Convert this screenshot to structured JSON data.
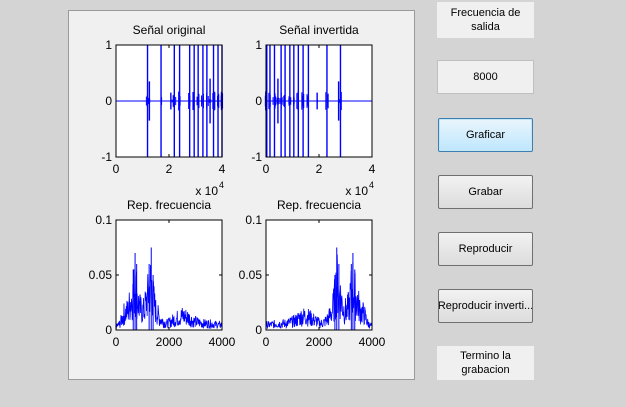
{
  "panel": {
    "freq_label_line1": "Frecuencia de",
    "freq_label_line2": "salida",
    "freq_value": "8000",
    "status_line1": "Termino la",
    "status_line2": "grabacion"
  },
  "buttons": {
    "graficar": "Graficar",
    "grabar": "Grabar",
    "reproducir": "Reproducir",
    "reproducir_invertida": "Reproducir inverti..."
  },
  "colors": {
    "signal": "#0000ff",
    "axes_bg": "#ffffff",
    "figure_bg": "#f0f0f0",
    "active_button": "#bee6fd"
  },
  "chart_data": [
    {
      "type": "line",
      "title": "Señal original",
      "xlabel": "",
      "ylabel": "",
      "xlim": [
        0,
        40000
      ],
      "ylim": [
        -1,
        1
      ],
      "x_ticks": [
        "0",
        "2",
        "4"
      ],
      "y_ticks": [
        "-1",
        "0",
        "1"
      ],
      "x_exponent": "x 10",
      "x_exponent_power": "4",
      "bursts": [
        {
          "x": 11900,
          "amp": 1.0
        },
        {
          "x": 12600,
          "amp": 0.35
        },
        {
          "x": 17000,
          "amp": 1.0
        },
        {
          "x": 20700,
          "amp": 0.15
        },
        {
          "x": 22000,
          "amp": 1.0
        },
        {
          "x": 24000,
          "amp": 1.0
        },
        {
          "x": 27800,
          "amp": 1.0
        },
        {
          "x": 29500,
          "amp": 1.0
        },
        {
          "x": 31000,
          "amp": 1.0
        },
        {
          "x": 32800,
          "amp": 1.0
        },
        {
          "x": 34300,
          "amp": 1.0
        },
        {
          "x": 35500,
          "amp": 0.4
        },
        {
          "x": 36800,
          "amp": 1.0
        },
        {
          "x": 38500,
          "amp": 1.0
        },
        {
          "x": 40000,
          "amp": 1.0
        }
      ]
    },
    {
      "type": "line",
      "title": "Señal invertida",
      "xlabel": "",
      "ylabel": "",
      "xlim": [
        0,
        40000
      ],
      "ylim": [
        -1,
        1
      ],
      "x_ticks": [
        "0",
        "2",
        "4"
      ],
      "y_ticks": [
        "-1",
        "0",
        "1"
      ],
      "x_exponent": "x 10",
      "x_exponent_power": "4",
      "bursts": [
        {
          "x": 300,
          "amp": 1.0
        },
        {
          "x": 1500,
          "amp": 1.0
        },
        {
          "x": 3200,
          "amp": 1.0
        },
        {
          "x": 4500,
          "amp": 0.4
        },
        {
          "x": 5700,
          "amp": 1.0
        },
        {
          "x": 7200,
          "amp": 1.0
        },
        {
          "x": 9000,
          "amp": 1.0
        },
        {
          "x": 10500,
          "amp": 1.0
        },
        {
          "x": 12200,
          "amp": 1.0
        },
        {
          "x": 14000,
          "amp": 1.0
        },
        {
          "x": 16000,
          "amp": 1.0
        },
        {
          "x": 19300,
          "amp": 0.15
        },
        {
          "x": 23000,
          "amp": 1.0
        },
        {
          "x": 27400,
          "amp": 0.35
        },
        {
          "x": 28100,
          "amp": 1.0
        }
      ]
    },
    {
      "type": "line",
      "title": "Rep. frecuencia",
      "xlabel": "",
      "ylabel": "",
      "xlim": [
        0,
        4000
      ],
      "ylim": [
        0,
        0.1
      ],
      "x_ticks": [
        "0",
        "2000",
        "4000"
      ],
      "y_ticks": [
        "0",
        "0.05",
        "0.1"
      ],
      "envelope": [
        [
          0,
          0.005
        ],
        [
          150,
          0.01
        ],
        [
          300,
          0.025
        ],
        [
          450,
          0.03
        ],
        [
          550,
          0.045
        ],
        [
          650,
          0.055
        ],
        [
          720,
          0.07
        ],
        [
          780,
          0.06
        ],
        [
          850,
          0.04
        ],
        [
          950,
          0.03
        ],
        [
          1050,
          0.03
        ],
        [
          1150,
          0.045
        ],
        [
          1250,
          0.06
        ],
        [
          1330,
          0.075
        ],
        [
          1400,
          0.05
        ],
        [
          1500,
          0.03
        ],
        [
          1650,
          0.018
        ],
        [
          1800,
          0.012
        ],
        [
          1950,
          0.01
        ],
        [
          2100,
          0.014
        ],
        [
          2300,
          0.018
        ],
        [
          2500,
          0.022
        ],
        [
          2700,
          0.02
        ],
        [
          2900,
          0.014
        ],
        [
          3100,
          0.012
        ],
        [
          3300,
          0.01
        ],
        [
          3500,
          0.01
        ],
        [
          3700,
          0.009
        ],
        [
          3850,
          0.008
        ],
        [
          4000,
          0.008
        ]
      ]
    },
    {
      "type": "line",
      "title": "Rep. frecuencia",
      "xlabel": "",
      "ylabel": "",
      "xlim": [
        0,
        4000
      ],
      "ylim": [
        0,
        0.1
      ],
      "x_ticks": [
        "0",
        "2000",
        "4000"
      ],
      "y_ticks": [
        "0",
        "0.05",
        "0.1"
      ],
      "envelope": [
        [
          0,
          0.008
        ],
        [
          150,
          0.008
        ],
        [
          300,
          0.009
        ],
        [
          500,
          0.01
        ],
        [
          700,
          0.01
        ],
        [
          900,
          0.012
        ],
        [
          1100,
          0.014
        ],
        [
          1300,
          0.02
        ],
        [
          1500,
          0.022
        ],
        [
          1700,
          0.018
        ],
        [
          1900,
          0.014
        ],
        [
          2050,
          0.01
        ],
        [
          2200,
          0.012
        ],
        [
          2350,
          0.018
        ],
        [
          2500,
          0.03
        ],
        [
          2600,
          0.05
        ],
        [
          2670,
          0.075
        ],
        [
          2750,
          0.06
        ],
        [
          2850,
          0.045
        ],
        [
          2950,
          0.03
        ],
        [
          3050,
          0.03
        ],
        [
          3150,
          0.04
        ],
        [
          3220,
          0.06
        ],
        [
          3280,
          0.07
        ],
        [
          3350,
          0.055
        ],
        [
          3450,
          0.045
        ],
        [
          3550,
          0.03
        ],
        [
          3700,
          0.025
        ],
        [
          3850,
          0.01
        ],
        [
          4000,
          0.005
        ]
      ]
    }
  ]
}
